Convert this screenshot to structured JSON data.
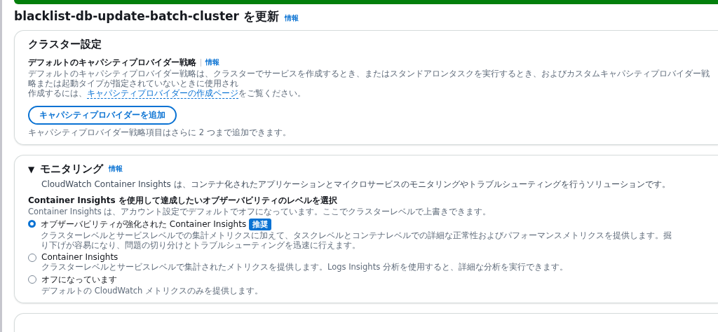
{
  "page_title": {
    "text": "blacklist-db-update-batch-cluster を更新",
    "info_link": "情報"
  },
  "cluster_settings": {
    "heading": "クラスター設定",
    "field_label": "デフォルトのキャパシティプロバイダー戦略",
    "info_link": "情報",
    "description_line": "デフォルトのキャパシティプロバイダー戦略は、クラスターでサービスを作成するとき、またはスタンドアロンタスクを実行するとき、およびカスタムキャパシティプロバイダー戦略または起動タイプが指定されていないときに使用され",
    "description_continued": {
      "before": "作成するには、",
      "link": "キャパシティプロバイダーの作成ページ",
      "after": "をご覧ください。"
    },
    "add_button": "キャパシティプロバイダーを追加",
    "hint": "キャパシティプロバイダー戦略項目はさらに 2 つまで追加できます。"
  },
  "monitoring": {
    "expanded": true,
    "toggle": "▼",
    "heading": "モニタリング",
    "info_link": "情報",
    "description": "CloudWatch Container Insights は、コンテナ化されたアプリケーションとマイクロサービスのモニタリングやトラブルシューティングを行うソリューションです。",
    "question": "Container Insights を使用して達成したいオブザーバビリティのレベルを選択",
    "question_hint": "Container Insights は、アカウント設定でデフォルトでオフになっています。ここでクラスターレベルで上書きできます。",
    "options": [
      {
        "label": "オブザーバビリティが強化された Container Insights",
        "badge": "推奨",
        "selected": true,
        "description": "クラスターレベルとサービスレベルでの集計メトリクスに加えて、タスクレベルとコンテナレベルでの詳細な正常性およびパフォーマンスメトリクスを提供します。掘り下げが容易になり、問題の切り分けとトラブルシューティングを迅速に行えます。"
      },
      {
        "label": "Container Insights",
        "selected": false,
        "description": "クラスターレベルとサービスレベルで集計されたメトリクスを提供します。Logs Insights 分析を使用すると、詳細な分析を実行できます。"
      },
      {
        "label": "オフになっています",
        "selected": false,
        "description": "デフォルトの CloudWatch メトリクスのみを提供します。"
      }
    ]
  }
}
